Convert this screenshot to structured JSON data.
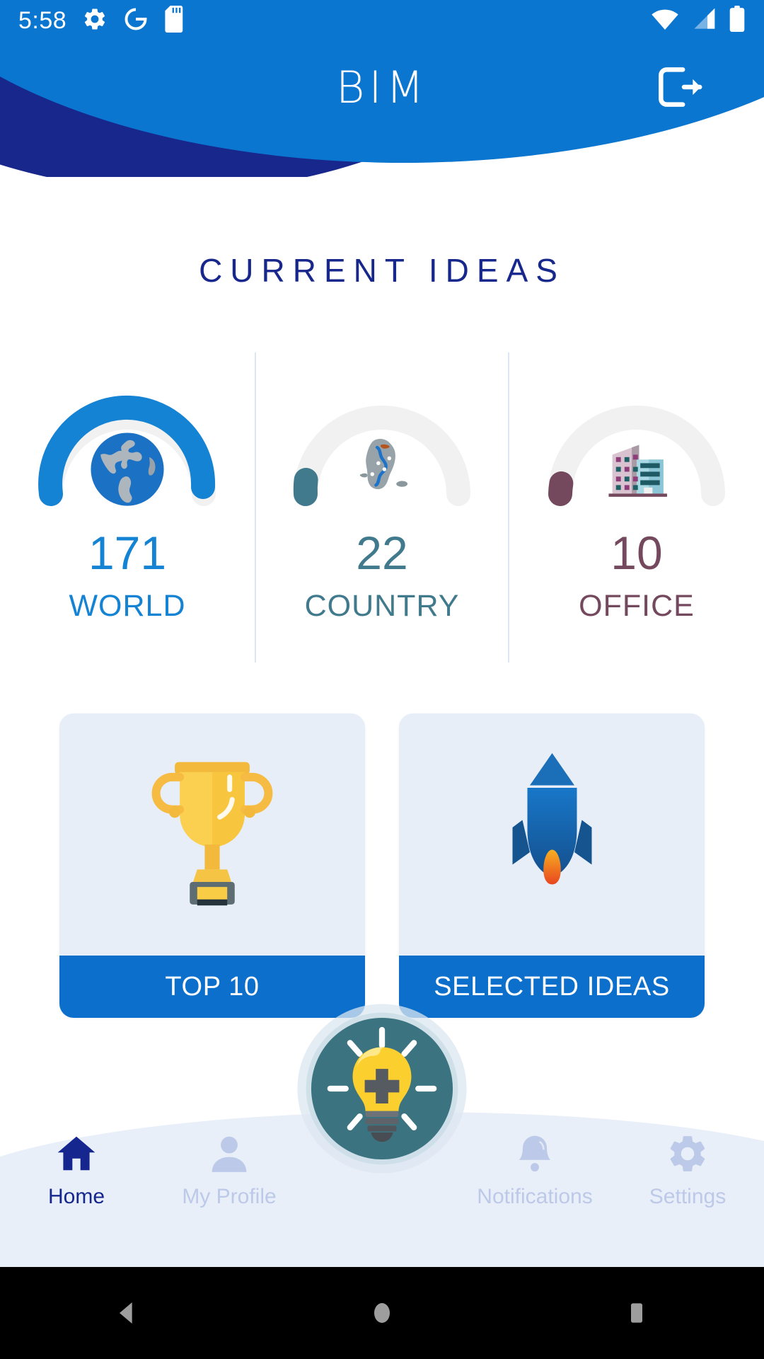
{
  "status_bar": {
    "time": "5:58",
    "left_icons": [
      "gear-icon",
      "google-g-icon",
      "sd-card-icon"
    ],
    "right_icons": [
      "wifi-icon",
      "cellular-signal-icon",
      "battery-icon"
    ],
    "background_color": "#0B76D0"
  },
  "header": {
    "app_logo": "BIM",
    "logout_icon": "logout-icon",
    "primary_color": "#0B76D0",
    "accent_color": "#17278C"
  },
  "main": {
    "page_title": "CURRENT IDEAS",
    "title_color": "#17278C",
    "stats": [
      {
        "value": "171",
        "label": "WORLD",
        "icon": "globe-icon",
        "color": "#1583D4",
        "track_color": "#F0F0F0",
        "percent": 88
      },
      {
        "value": "22",
        "label": "COUNTRY",
        "icon": "korea-map-icon",
        "color": "#407A8C",
        "track_color": "#F0F0F0",
        "percent": 9
      },
      {
        "value": "10",
        "label": "OFFICE",
        "icon": "office-building-icon",
        "color": "#74495E",
        "track_color": "#F0F0F0",
        "percent": 6
      }
    ],
    "cards": [
      {
        "label": "TOP 10",
        "icon": "trophy-icon",
        "footer_color": "#0B6FCB",
        "surface_color": "#E7EEF8"
      },
      {
        "label": "SELECTED IDEAS",
        "icon": "rocket-icon",
        "footer_color": "#0B6FCB",
        "surface_color": "#E7EEF8"
      }
    ]
  },
  "fab": {
    "icon": "lightbulb-plus-icon",
    "circle_color": "#3B7480",
    "ring_color": "#DCE7F0",
    "bulb_color": "#FBCF2E"
  },
  "bottom_nav": {
    "background_color": "#E9EFF9",
    "active_color": "#15268E",
    "inactive_color": "#BCC9E8",
    "items": [
      {
        "label": "Home",
        "icon": "home-icon",
        "active": true
      },
      {
        "label": "My Profile",
        "icon": "user-icon",
        "active": false
      },
      {
        "label": "Notifications",
        "icon": "bell-icon",
        "active": false
      },
      {
        "label": "Settings",
        "icon": "gear-icon",
        "active": false
      }
    ]
  },
  "system_nav": {
    "back": "back-triangle-icon",
    "home": "home-circle-icon",
    "recents": "recents-square-icon",
    "background_color": "#000000",
    "icon_color": "#9E9E9E"
  }
}
